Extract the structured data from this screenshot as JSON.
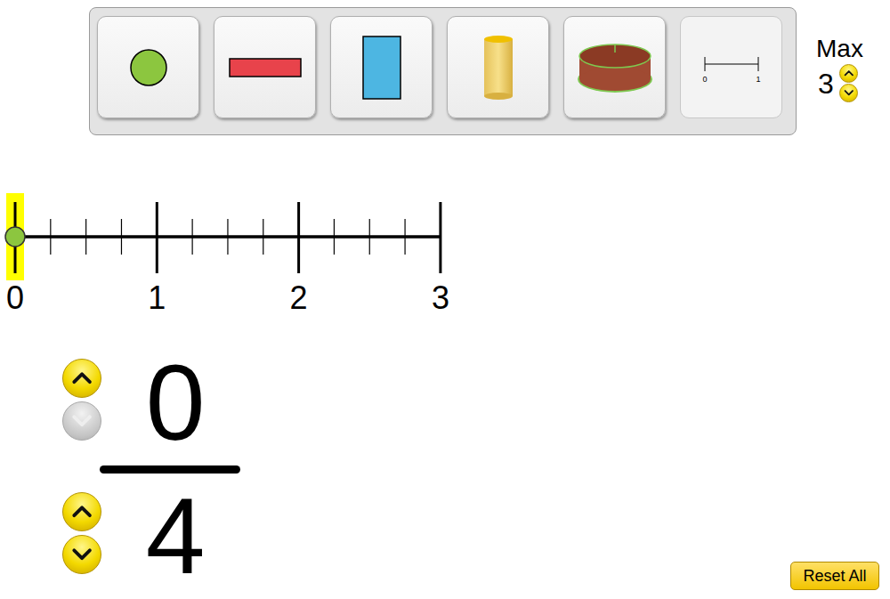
{
  "toolbar": {
    "tools": [
      {
        "kind": "circle",
        "selected": false
      },
      {
        "kind": "bar",
        "selected": false
      },
      {
        "kind": "rectangle",
        "selected": false
      },
      {
        "kind": "cylinder",
        "selected": false
      },
      {
        "kind": "cake",
        "selected": false
      },
      {
        "kind": "numberline",
        "selected": true,
        "labels": [
          "0",
          "1"
        ]
      }
    ]
  },
  "max": {
    "label": "Max",
    "value": "3",
    "up_disabled": false,
    "down_disabled": false
  },
  "number_line": {
    "labels": [
      "0",
      "1",
      "2",
      "3"
    ],
    "marker": {
      "selected": true
    }
  },
  "fraction": {
    "numerator": {
      "value": "0",
      "up_disabled": false,
      "down_disabled": true
    },
    "denominator": {
      "value": "4",
      "up_disabled": false,
      "down_disabled": false
    }
  },
  "buttons": [
    "Reset All"
  ]
}
